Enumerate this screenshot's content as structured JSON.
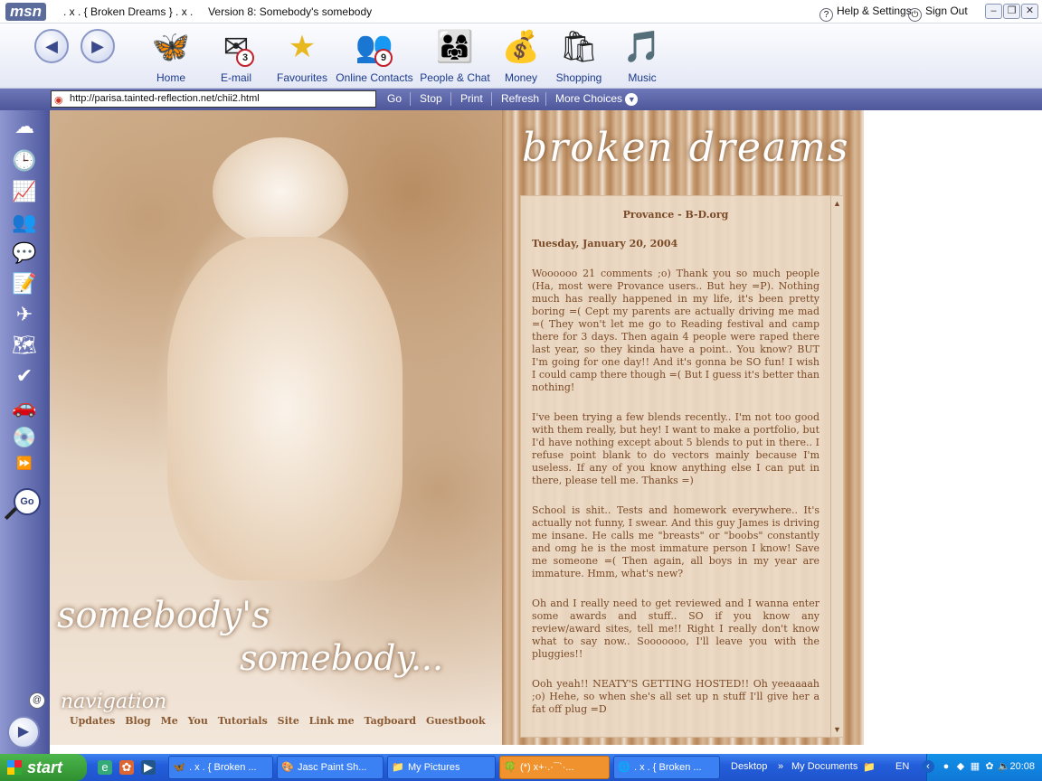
{
  "window": {
    "logo": "msn",
    "title": ". x . { Broken Dreams } . x .",
    "subtitle": "Version 8: Somebody's somebody",
    "help": "Help & Settings",
    "signout": "Sign Out",
    "minimize": "–",
    "restore": "❐",
    "close": "✕"
  },
  "toolbar": {
    "back": "◀",
    "forward": "▶",
    "items": [
      {
        "label": "Home",
        "icon": "🦋",
        "badge": ""
      },
      {
        "label": "E-mail",
        "icon": "✉",
        "badge": "3"
      },
      {
        "label": "Favourites",
        "icon": "★",
        "badge": ""
      },
      {
        "label": "Online Contacts",
        "icon": "👥",
        "badge": "9"
      },
      {
        "label": "People & Chat",
        "icon": "👨‍👩‍👧",
        "badge": ""
      },
      {
        "label": "Money",
        "icon": "💰",
        "badge": ""
      },
      {
        "label": "Shopping",
        "icon": "🛍",
        "badge": ""
      },
      {
        "label": "Music",
        "icon": "🎵",
        "badge": ""
      }
    ]
  },
  "address": {
    "url": "http://parisa.tainted-reflection.net/chii2.html",
    "go": "Go",
    "stop": "Stop",
    "print": "Print",
    "refresh": "Refresh",
    "more": "More Choices"
  },
  "sidebar": {
    "icons": [
      "☁",
      "🕒",
      "📈",
      "👥",
      "💬",
      "📝",
      "✈",
      "🗺",
      "✔",
      "🚗",
      "💿",
      "⏩"
    ],
    "search_label": "Go",
    "play": "▶",
    "small": "@"
  },
  "page": {
    "brand": "broken dreams",
    "art_script_1": "somebody's",
    "art_script_2": "somebody...",
    "nav_heading": "navigation",
    "nav_links": [
      "Updates",
      "Blog",
      "Me",
      "You",
      "Tutorials",
      "Site",
      "Link me",
      "Tagboard",
      "Guestbook"
    ],
    "site_name": "Provance - B-D.org",
    "date": "Tuesday, January 20, 2004",
    "paragraphs": [
      "Woooooo 21 comments ;o) Thank you so much people (Ha, most were Provance users.. But hey =P). Nothing much has really happened in my life, it's been pretty boring =( Cept my parents are actually driving me mad =( They won't let me go to Reading festival and camp there for 3 days. Then again 4 people were raped there last year, so they kinda have a point.. You know? BUT I'm going for one day!! And it's gonna be SO fun! I wish I could camp there though =( But I guess it's better than nothing!",
      "I've been trying a few blends recently.. I'm not too good with them really, but hey! I want to make a portfolio, but I'd have nothing except about 5 blends to put in there.. I refuse point blank to do vectors mainly because I'm useless. If any of you know anything else I can put in there, please tell me. Thanks =)",
      "School is shit.. Tests and homework everywhere.. It's actually not funny, I swear. And this guy James is driving me insane. He calls me \"breasts\" or \"boobs\" constantly and omg he is the most immature person I know! Save me someone =( Then again, all boys in my year are immature. Hmm, what's new?",
      "Oh and I really need to get reviewed and I wanna enter some awards and stuff.. SO if you know any review/award sites, tell me!! Right I really don't know what to say now.. Sooooooo, I'll leave you with the pluggies!!",
      "Ooh yeah!! NEATY'S GETTING HOSTED!! Oh yeeaaaah ;o) Hehe, so when she's all set up n stuff I'll give her a fat off plug =D"
    ]
  },
  "taskbar": {
    "start": "start",
    "tasks": [
      {
        "label": ". x . { Broken ...",
        "icon": "🦋",
        "active": false
      },
      {
        "label": "Jasc Paint Sh...",
        "icon": "🎨",
        "active": false
      },
      {
        "label": "My Pictures",
        "icon": "📁",
        "active": false
      },
      {
        "label": "(*) x+·.·¯`·...",
        "icon": "🍀",
        "active": true
      },
      {
        "label": ". x . { Broken ...",
        "icon": "🌐",
        "active": false
      }
    ],
    "desktop": "Desktop",
    "mydocs": "My Documents",
    "lang": "EN",
    "clock": "20:08"
  },
  "colors": {
    "accent": "#4d579a",
    "text_brown": "#7b4a27",
    "start_green": "#3a9f3a",
    "taskbar_blue": "#245edb"
  }
}
